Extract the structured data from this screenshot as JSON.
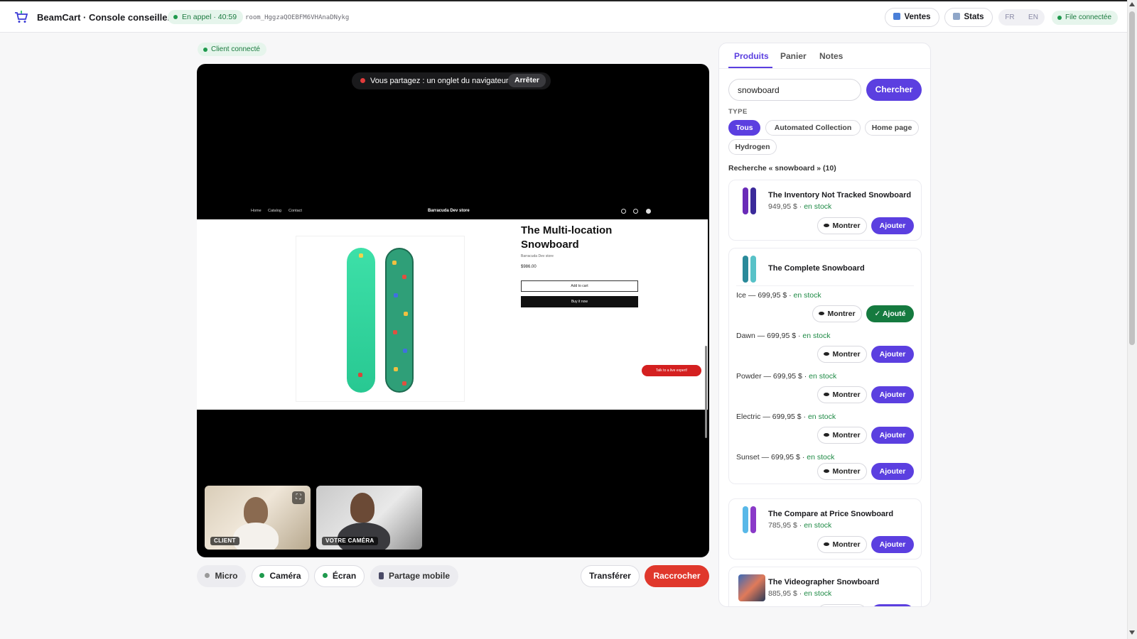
{
  "header": {
    "title": "BeamCart · Console conseiller",
    "call_status": "En appel · 40:59",
    "room_id": "room_HggzaQOEBFM6VHAnaDNykg",
    "sales_label": "Ventes",
    "stats_label": "Stats",
    "lang_fr": "FR",
    "lang_en": "EN",
    "queue_status": "File connectée"
  },
  "stage": {
    "client_status": "Client connecté",
    "share_text": "Vous partagez : un onglet du navigateur",
    "stop_label": "Arrêter",
    "shop": {
      "nav_home": "Home",
      "nav_catalog": "Catalog",
      "nav_contact": "Contact",
      "store_name": "Barracuda Dev store",
      "product_title": "The Multi-location Snowboard",
      "vendor": "Barracuda Dev store",
      "price": "$986.00",
      "add_to_cart": "Add to cart",
      "buy_now": "Buy it now",
      "expert_btn": "Talk to a live expert!"
    },
    "client_tile_label": "CLIENT",
    "self_tile_label": "VOTRE CAMÉRA"
  },
  "controls": {
    "mic": "Micro",
    "camera": "Caméra",
    "screen": "Écran",
    "mobile_share": "Partage mobile",
    "transfer": "Transférer",
    "hangup": "Raccrocher"
  },
  "panel": {
    "tabs": [
      "Produits",
      "Panier",
      "Notes"
    ],
    "search_value": "snowboard",
    "search_btn": "Chercher",
    "type_label": "TYPE",
    "chips": [
      "Tous",
      "Automated Collection",
      "Home page",
      "Hydrogen"
    ],
    "result_count": "Recherche « snowboard » (10)",
    "show_label": "Montrer",
    "add_label": "Ajouter",
    "added_label": "✓ Ajouté",
    "products": [
      {
        "title": "The Inventory Not Tracked Snowboard",
        "price": "949,95 $ · ",
        "stock": "en stock"
      },
      {
        "title": "The Complete Snowboard"
      },
      {
        "title": "The Compare at Price Snowboard",
        "price": "785,95 $ · ",
        "stock": "en stock"
      },
      {
        "title": "The Videographer Snowboard",
        "price": "885,95 $ · ",
        "stock": "en stock"
      }
    ],
    "variants": [
      {
        "label": "Ice — 699,95 $ · ",
        "stock": "en stock"
      },
      {
        "label": "Dawn — 699,95 $ · ",
        "stock": "en stock"
      },
      {
        "label": "Powder — 699,95 $ · ",
        "stock": "en stock"
      },
      {
        "label": "Electric — 699,95 $ · ",
        "stock": "en stock"
      },
      {
        "label": "Sunset — 699,95 $ · ",
        "stock": "en stock"
      }
    ]
  },
  "colors": {
    "accent": "#5b3fe0",
    "success": "#1e8a45",
    "danger": "#e0382c"
  }
}
